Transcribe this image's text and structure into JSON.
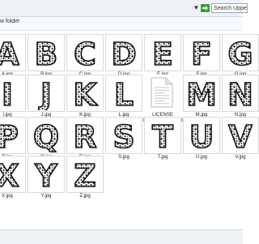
{
  "toolbar": {
    "search_placeholder": "Search Uppercase",
    "go_icon": "green-arrow-icon",
    "dropdown_icon": "chevron-down-icon"
  },
  "title": {
    "folder_label": "w folder"
  },
  "colors": {
    "toolbar_bg": "#eef2f7",
    "go_green": "#3a9a3a",
    "letter_fill": "#ffffff",
    "letter_dots": "#111111"
  },
  "files": [
    {
      "name": "A.jpg",
      "letter": "A"
    },
    {
      "name": "B.jpg",
      "letter": "B"
    },
    {
      "name": "C.jpg",
      "letter": "C"
    },
    {
      "name": "D.jpg",
      "letter": "D"
    },
    {
      "name": "E.jpg",
      "letter": "E"
    },
    {
      "name": "F.jpg",
      "letter": "F"
    },
    {
      "name": "G.jpg",
      "letter": "G"
    },
    {
      "name": "I.jpg",
      "letter": "I"
    },
    {
      "name": "J.jpg",
      "letter": "J"
    },
    {
      "name": "K.jpg",
      "letter": "K"
    },
    {
      "name": "L.jpg",
      "letter": "L"
    },
    {
      "name": "LICENSE INFORMATION.txt",
      "letter": ""
    },
    {
      "name": "M.jpg",
      "letter": "M"
    },
    {
      "name": "N.jpg",
      "letter": "N"
    },
    {
      "name": "P.jpg",
      "letter": "P"
    },
    {
      "name": "Q.jpg",
      "letter": "Q"
    },
    {
      "name": "R.jpg",
      "letter": "R"
    },
    {
      "name": "S.jpg",
      "letter": "S"
    },
    {
      "name": "T.jpg",
      "letter": "T"
    },
    {
      "name": "U.jpg",
      "letter": "U"
    },
    {
      "name": "V.jpg",
      "letter": "V"
    },
    {
      "name": "X.jpg",
      "letter": "X"
    },
    {
      "name": "Y.jpg",
      "letter": "Y"
    },
    {
      "name": "Z.jpg",
      "letter": "Z"
    }
  ]
}
